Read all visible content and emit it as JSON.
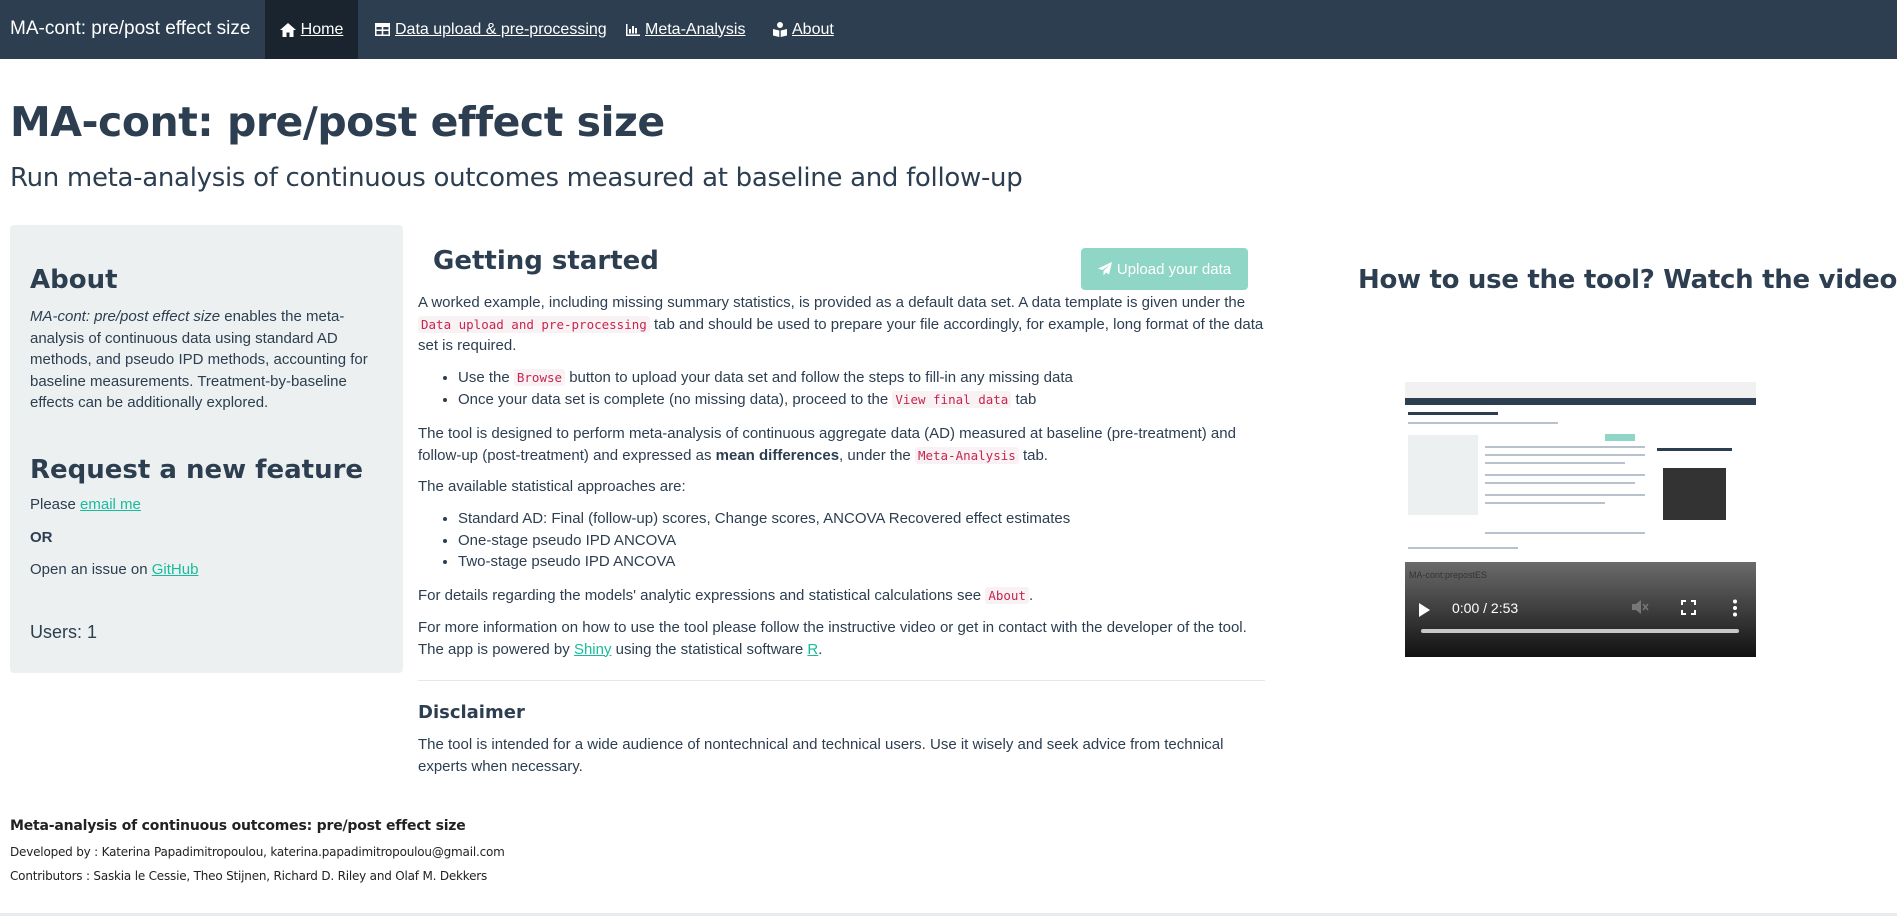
{
  "navbar": {
    "brand": "MA-cont: pre/post effect size",
    "items": [
      {
        "label": "Home",
        "icon": "home-icon"
      },
      {
        "label": "Data upload & pre-processing",
        "icon": "table-icon"
      },
      {
        "label": "Meta-Analysis",
        "icon": "bar-chart-icon"
      },
      {
        "label": "About",
        "icon": "book-reader-icon"
      }
    ]
  },
  "header": {
    "title": "MA-cont: pre/post effect size",
    "subtitle": "Run meta-analysis of continuous outcomes measured at baseline and follow-up"
  },
  "sidebar": {
    "about_heading": "About",
    "about_em": "MA-cont: pre/post effect size",
    "about_text": " enables the meta-analysis of continuous data using standard AD methods, and pseudo IPD methods, accounting for baseline measurements. Treatment-by-baseline effects can be additionally explored.",
    "request_heading": "Request a new feature",
    "please": "Please ",
    "email_link": "email me",
    "or": "OR",
    "issue_text": "Open an issue on ",
    "github_link": "GitHub",
    "users": "Users: 1"
  },
  "main": {
    "getting_started": "Getting started",
    "upload_button": "Upload your data",
    "p1_a": "A worked example, including missing summary statistics, is provided as a default data set. A data template is given under the ",
    "p1_code": "Data upload and pre-processing",
    "p1_b": " tab and should be used to prepare your file accordingly, for example, long format of the data set is required.",
    "li1_a": "Use the ",
    "li1_code": "Browse",
    "li1_b": " button to upload your data set and follow the steps to fill-in any missing data",
    "li2_a": "Once your data set is complete (no missing data), proceed to the ",
    "li2_code": "View final data",
    "li2_b": " tab",
    "p2_a": "The tool is designed to perform meta-analysis of continuous aggregate data (AD) measured at baseline (pre-treatment) and follow-up (post-treatment) and expressed as ",
    "p2_bold": "mean differences",
    "p2_b": ", under the ",
    "p2_code": "Meta-Analysis",
    "p2_c": " tab.",
    "p3": "The available statistical approaches are:",
    "approaches": [
      "Standard AD: Final (follow-up) scores, Change scores, ANCOVA Recovered effect estimates",
      "One-stage pseudo IPD ANCOVA",
      "Two-stage pseudo IPD ANCOVA"
    ],
    "p4_a": "For details regarding the models' analytic expressions and statistical calculations see ",
    "p4_code": "About",
    "p4_b": ".",
    "p5_a": "For more information on how to use the tool please follow the instructive video or get in contact with the developer of the tool. The app is powered by ",
    "p5_link1": "Shiny",
    "p5_b": " using the statistical software ",
    "p5_link2": "R",
    "p5_c": ".",
    "disclaimer_heading": "Disclaimer",
    "disclaimer_text": "The tool is intended for a wide audience of nontechnical and technical users. Use it wisely and seek advice from technical experts when necessary."
  },
  "video": {
    "heading": "How to use the tool? Watch the video !",
    "label": "MA-cont:prepostES",
    "time": "0:00 / 2:53",
    "progress": 0
  },
  "footer": {
    "title": "Meta-analysis of continuous outcomes: pre/post effect size",
    "developed": "Developed by : Katerina Papadimitropoulou, katerina.papadimitropoulou@gmail.com",
    "contributors": "Contributors : Saskia le Cessie, Theo Stijnen, Richard D. Riley and Olaf M. Dekkers"
  },
  "colors": {
    "navbar": "#2c3e50",
    "navbar_active": "#1a242f",
    "accent": "#18bc9c",
    "button_disabled": "#8fd6c6",
    "sidebar_bg": "#ecf0f1",
    "code": "#c7254e"
  }
}
